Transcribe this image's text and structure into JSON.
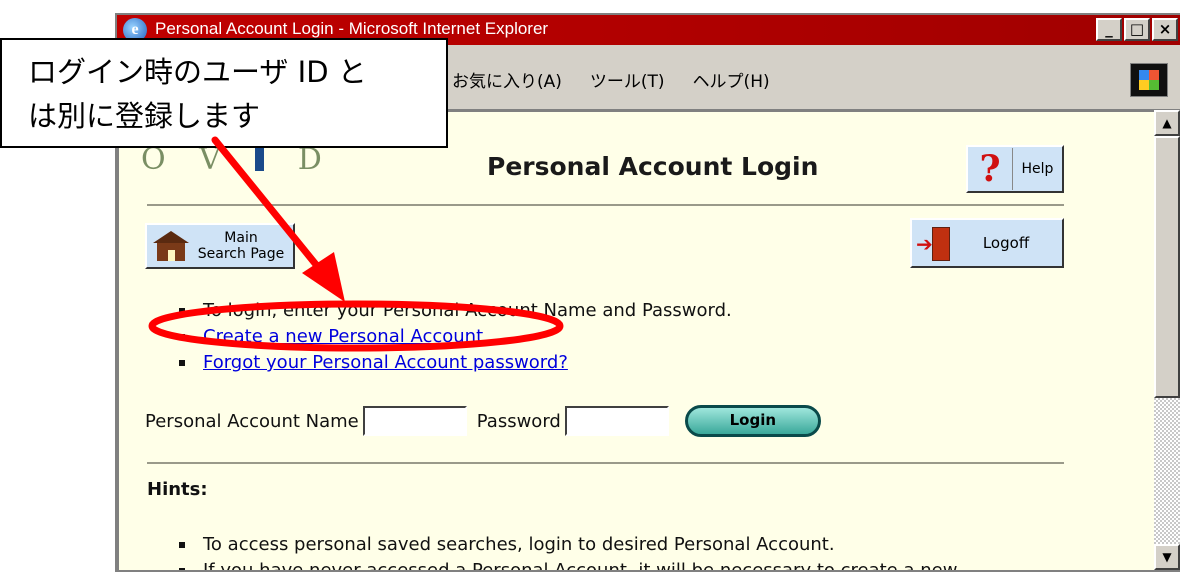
{
  "window": {
    "title": "Personal Account Login - Microsoft Internet Explorer",
    "title_icon": "ie-icon",
    "controls": [
      "minimize-icon",
      "restore-icon",
      "close-icon"
    ],
    "control_glyphs": [
      "_",
      "□",
      "×"
    ]
  },
  "menubar": {
    "items": [
      "お気に入り(A)",
      "ツール(T)",
      "ヘルプ(H)"
    ]
  },
  "page": {
    "logo_letters": [
      "O",
      "V",
      "D"
    ],
    "heading": "Personal Account Login",
    "help_label": "Help",
    "help_glyph": "?",
    "main_search_label_line1": "Main",
    "main_search_label_line2": "Search Page",
    "logoff_label": "Logoff",
    "instructions": {
      "intro": "To login, enter your Personal Account Name and Password.",
      "create_link": "Create a new Personal Account",
      "forgot_link": "Forgot your Personal Account password?"
    },
    "login_form": {
      "account_name_label": "Personal Account Name",
      "account_name_value": "",
      "password_label": "Password",
      "password_value": "",
      "login_button": "Login"
    },
    "hints": {
      "title": "Hints:",
      "items": [
        "To access personal saved searches, login to desired Personal Account.",
        "If you have never accessed a Personal Account, it will be necessary to create a new"
      ]
    }
  },
  "scrollbar": {
    "up_glyph": "▲",
    "down_glyph": "▼"
  },
  "annotation": {
    "line1": "ログイン時のユーザ ID と",
    "line2": "は別に登録します",
    "arrow_color": "#ff0000",
    "ellipse_color": "#ff0000"
  }
}
